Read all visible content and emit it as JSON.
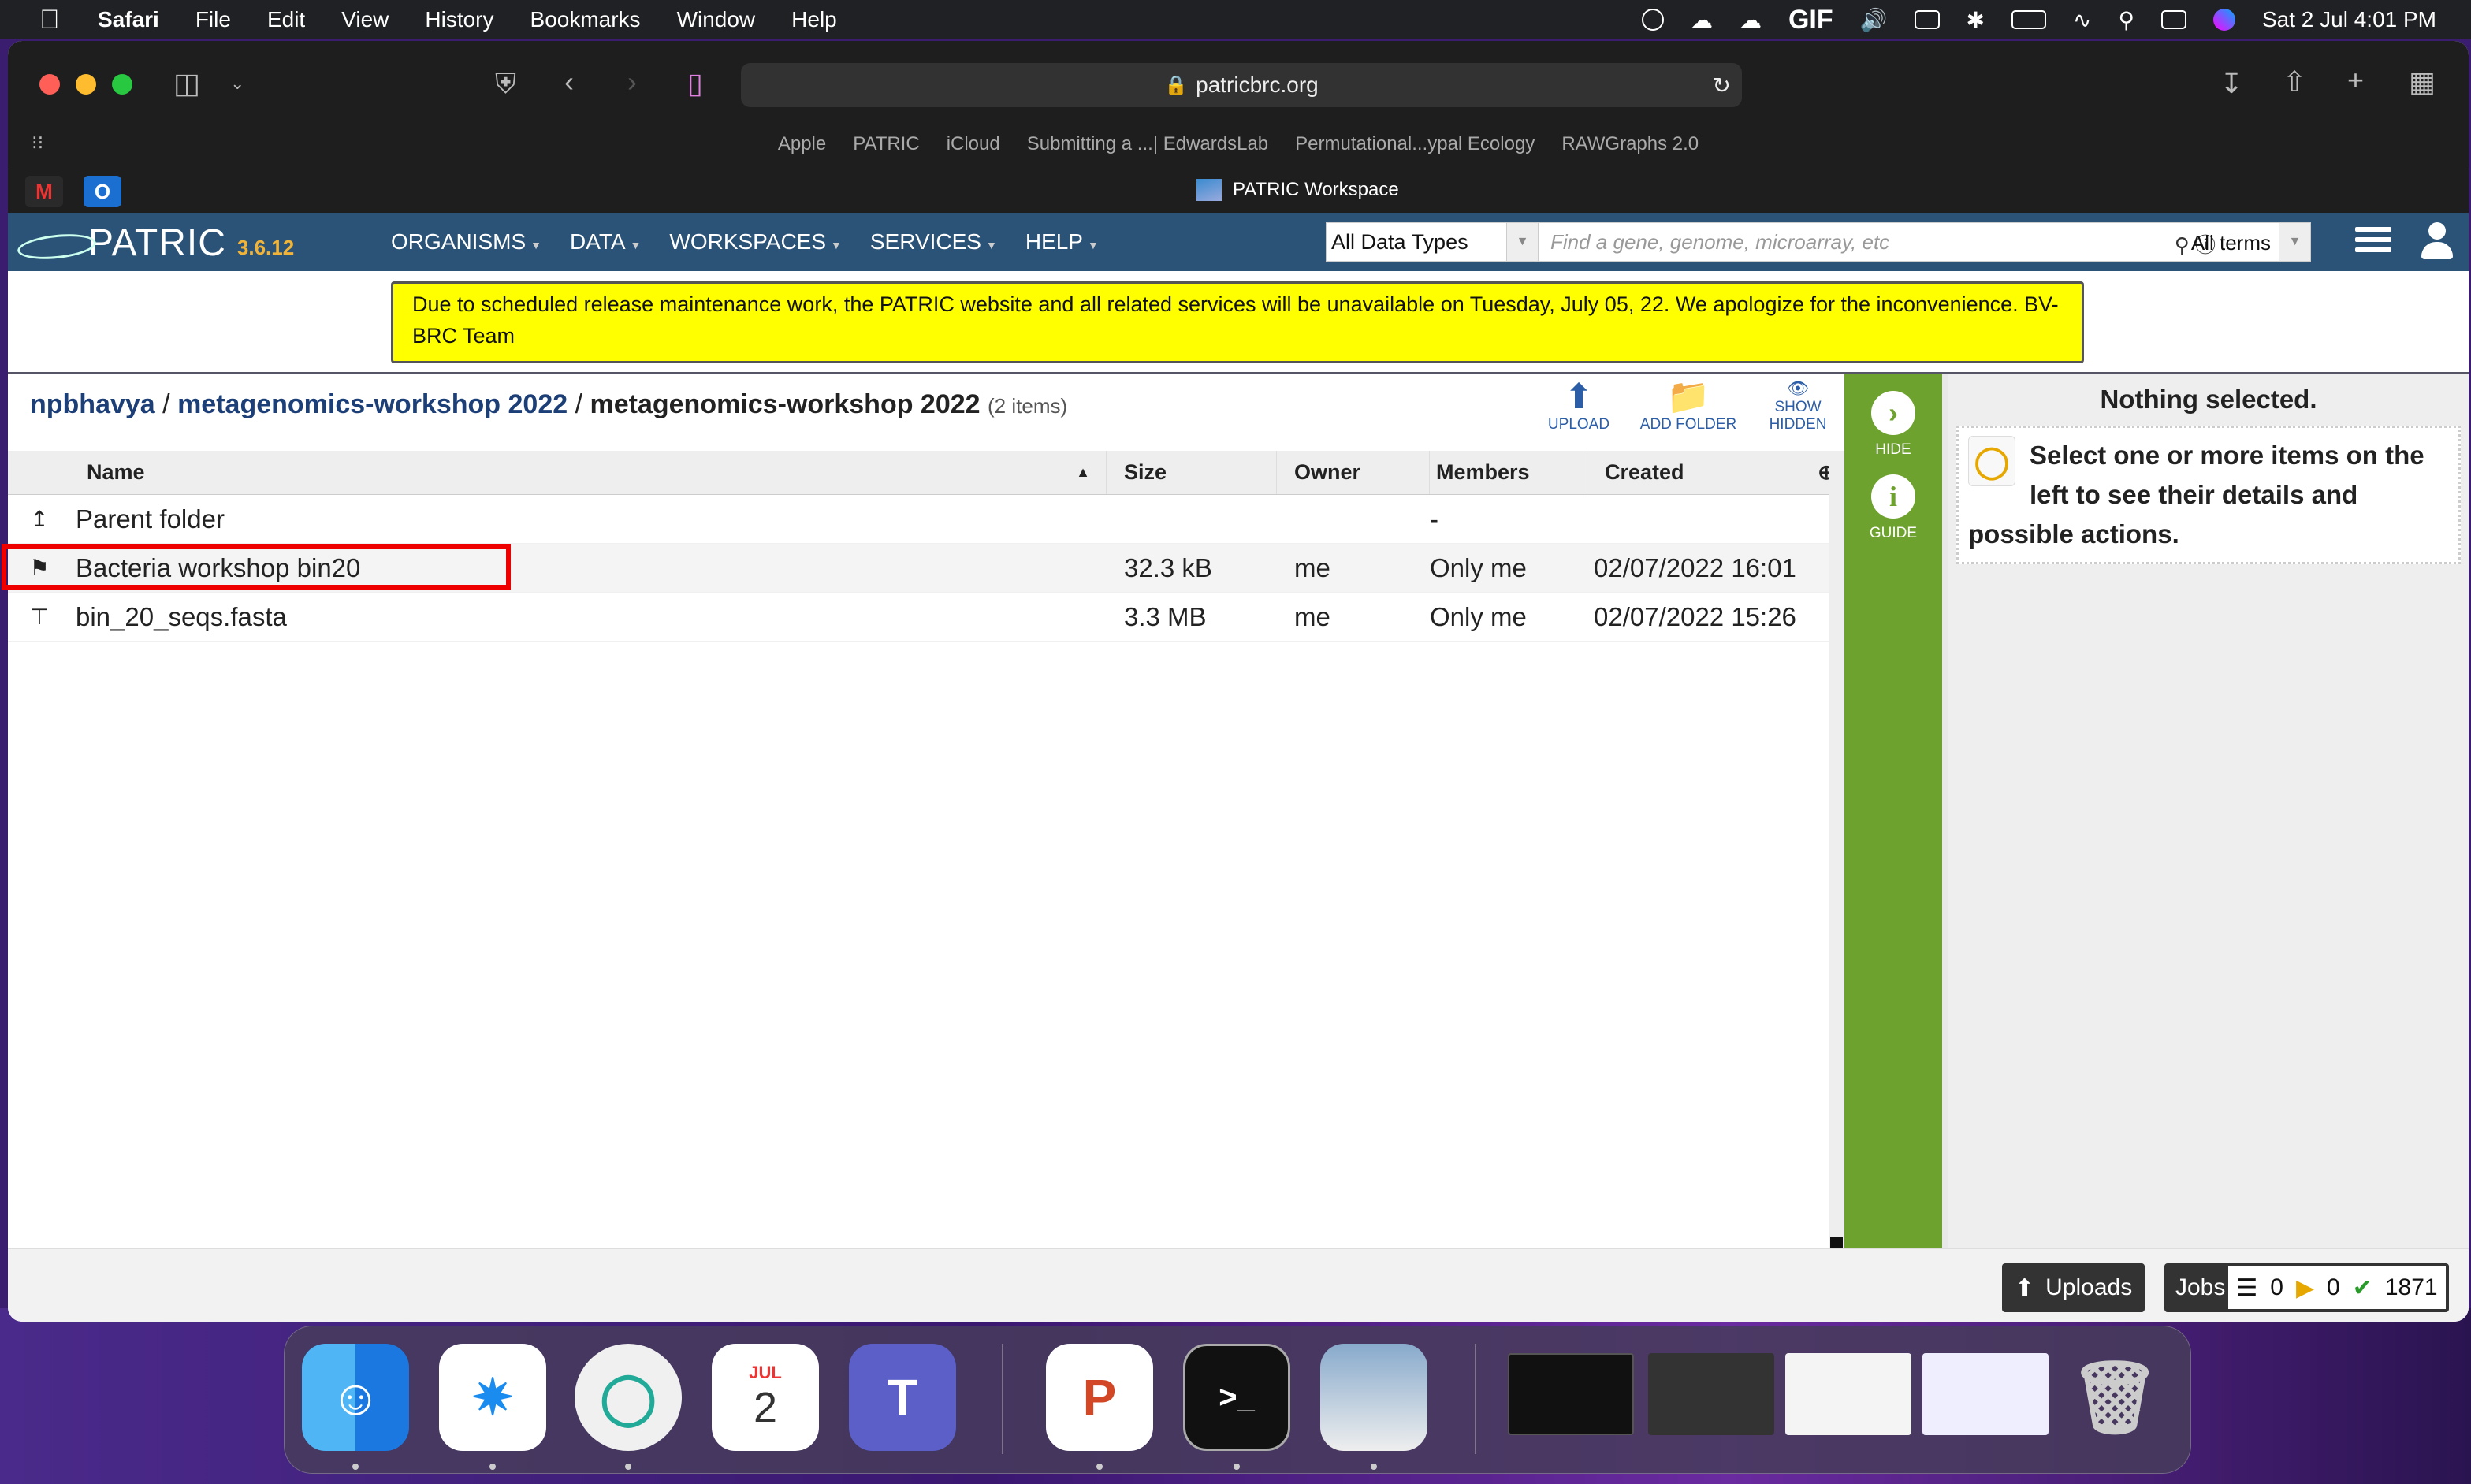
{
  "menubar": {
    "app": "Safari",
    "menus": [
      "File",
      "Edit",
      "View",
      "History",
      "Bookmarks",
      "Window",
      "Help"
    ],
    "clock": "Sat 2 Jul  4:01 PM",
    "gif_label": "GIF"
  },
  "browser": {
    "url": "patricbrc.org",
    "favorites": [
      "Apple",
      "PATRIC",
      "iCloud",
      "Submitting a ...| EdwardsLab",
      "Permutational...ypal Ecology",
      "RAWGraphs 2.0"
    ],
    "tab_title": "PATRIC Workspace",
    "pinned": [
      "M",
      "O"
    ]
  },
  "patric": {
    "logo": "PATRIC",
    "version": "3.6.12",
    "nav": [
      "ORGANISMS",
      "DATA",
      "WORKSPACES",
      "SERVICES",
      "HELP"
    ],
    "data_type": "All Data Types",
    "search_placeholder": "Find a gene, genome, microarray, etc",
    "search_terms": "All terms",
    "notice": "Due to scheduled release maintenance work, the PATRIC website and all related services will be unavailable on Tuesday, July 05, 22. We apologize for the inconvenience. BV-BRC Team"
  },
  "workspace": {
    "crumbs": [
      "npbhavya",
      "metagenomics-workshop 2022"
    ],
    "current": "metagenomics-workshop 2022",
    "count": "(2 items)",
    "tools": {
      "upload": "UPLOAD",
      "add_folder": "ADD FOLDER",
      "show": "SHOW",
      "hidden": "HIDDEN"
    },
    "columns": [
      "Name",
      "Size",
      "Owner",
      "Members",
      "Created"
    ],
    "parent": {
      "name": "Parent folder",
      "members": "-"
    },
    "rows": [
      {
        "name": "Bacteria workshop bin20",
        "size": "32.3 kB",
        "owner": "me",
        "members": "Only me",
        "created": "02/07/2022 16:01"
      },
      {
        "name": "bin_20_seqs.fasta",
        "size": "3.3 MB",
        "owner": "me",
        "members": "Only me",
        "created": "02/07/2022 15:26"
      }
    ],
    "side": {
      "hide": "HIDE",
      "guide": "GUIDE"
    },
    "detail": {
      "title": "Nothing selected.",
      "message": "Select one or more items on the left to see their details and possible actions."
    },
    "footer": {
      "uploads": "Uploads",
      "jobs": "Jobs",
      "queued": "0",
      "running": "0",
      "done": "1871"
    }
  },
  "dock": {
    "calendar_month": "JUL",
    "calendar_day": "2"
  },
  "colors": {
    "nav": "#2b5378",
    "notice": "#ffff00",
    "sidebar": "#6ea22e",
    "highlight": "#e00000"
  }
}
